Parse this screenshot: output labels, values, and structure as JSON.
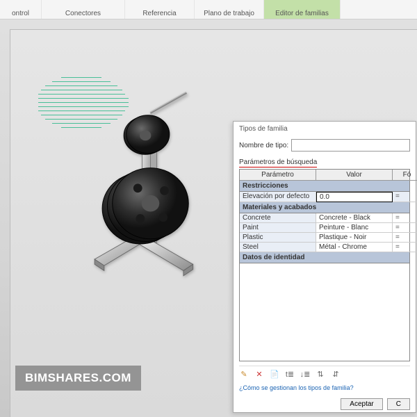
{
  "ribbon": {
    "tabs": [
      {
        "label": "ontrol"
      },
      {
        "label": "Conectores"
      },
      {
        "label": "Referencia"
      },
      {
        "label": "Plano de trabajo"
      },
      {
        "label": "Editor de familias",
        "active": true
      }
    ]
  },
  "watermark": "BIMSHARES.COM",
  "dialog": {
    "title": "Tipos de familia",
    "name_label": "Nombre de tipo:",
    "name_value": "",
    "search_label": "Parámetros de búsqueda",
    "columns": {
      "param": "Parámetro",
      "value": "Valor",
      "formula": "Fó"
    },
    "groups": [
      {
        "name": "Restricciones",
        "rows": [
          {
            "param": "Elevación por defecto",
            "value": "0.0",
            "f": "=",
            "active": true
          }
        ]
      },
      {
        "name": "Materiales y acabados",
        "rows": [
          {
            "param": "Concrete",
            "value": "Concrete - Black",
            "f": "="
          },
          {
            "param": "Paint",
            "value": "Peinture - Blanc",
            "f": "="
          },
          {
            "param": "Plastic",
            "value": "Plastique - Noir",
            "f": "="
          },
          {
            "param": "Steel",
            "value": "Métal - Chrome",
            "f": "="
          }
        ]
      },
      {
        "name": "Datos de identidad",
        "rows": []
      }
    ],
    "help_link": "¿Cómo se gestionan los tipos de familia?",
    "buttons": {
      "ok": "Aceptar",
      "cancel": "C"
    }
  },
  "icons": {
    "pencil": "✎",
    "x": "✕",
    "copy": "📄",
    "up": "t≣",
    "down": "↓≣",
    "sortaz": "⇅",
    "sortza": "⇵"
  }
}
